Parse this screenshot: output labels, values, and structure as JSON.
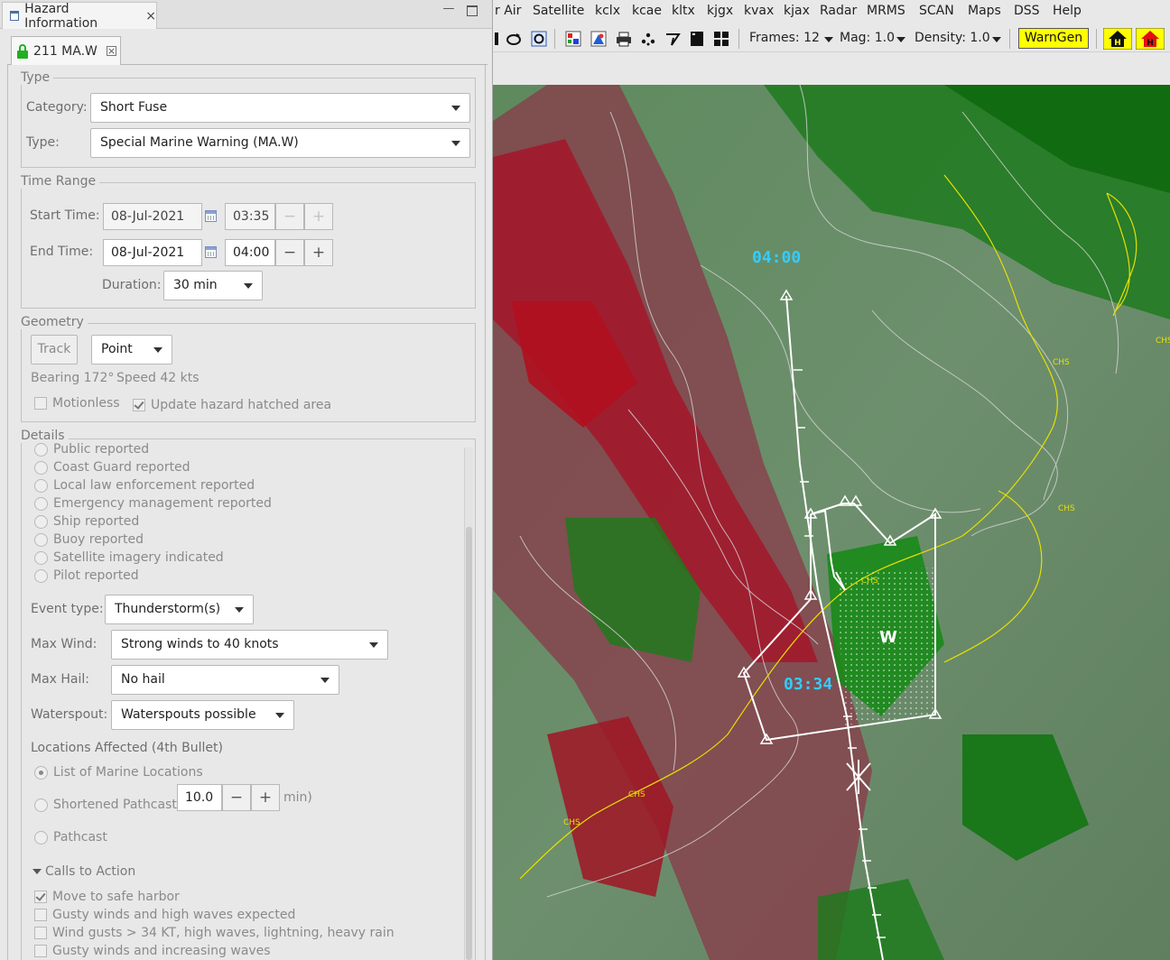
{
  "view": {
    "title": "Hazard Information"
  },
  "tab": {
    "label": "211 MA.W"
  },
  "type_group": {
    "title": "Type",
    "category_label": "Category:",
    "category_value": "Short Fuse",
    "type_label": "Type:",
    "type_value": "Special Marine Warning (MA.W)"
  },
  "time_range": {
    "title": "Time Range",
    "start_label": "Start Time:",
    "start_date": "08-Jul-2021",
    "start_time": "03:35",
    "end_label": "End Time:",
    "end_date": "08-Jul-2021",
    "end_time": "04:00",
    "duration_label": "Duration:",
    "duration_value": "30 min",
    "minus": "−",
    "plus": "+"
  },
  "geometry": {
    "title": "Geometry",
    "track_label": "Track",
    "mode_value": "Point",
    "bearing": "Bearing 172°",
    "speed": "Speed 42 kts",
    "motionless": "Motionless",
    "update_hatched": "Update hazard hatched area"
  },
  "details": {
    "title": "Details",
    "sources": [
      "Public reported",
      "Coast Guard reported",
      "Local law enforcement reported",
      "Emergency management reported",
      "Ship reported",
      "Buoy reported",
      "Satellite imagery indicated",
      "Pilot reported"
    ],
    "event_type_label": "Event type:",
    "event_type_value": "Thunderstorm(s)",
    "max_wind_label": "Max Wind:",
    "max_wind_value": "Strong winds to 40 knots",
    "max_hail_label": "Max Hail:",
    "max_hail_value": "No hail",
    "waterspout_label": "Waterspout:",
    "waterspout_value": "Waterspouts possible",
    "locations_title": "Locations Affected (4th Bullet)",
    "loc_list": "List of Marine Locations",
    "loc_short_prefix": "Shortened Pathcast (",
    "loc_short_value": "10.0",
    "loc_short_suffix": "min)",
    "loc_pathcast": "Pathcast",
    "cta_title": "Calls to Action",
    "cta": [
      "Move to safe harbor",
      "Gusty winds and high waves expected",
      "Wind gusts > 34 KT, high waves, lightning, heavy rain",
      "Gusty winds and increasing waves"
    ]
  },
  "menu": [
    "r Air",
    "Satellite",
    "kclx",
    "kcae",
    "kltx",
    "kjgx",
    "kvax",
    "kjax",
    "Radar",
    "MRMS",
    "SCAN",
    "Maps",
    "DSS",
    "Help"
  ],
  "toolbar": {
    "frames": "Frames: 12",
    "mag": "Mag: 1.0",
    "density": "Density: 1.0",
    "warngen": "WarnGen"
  },
  "map": {
    "time_end": "04:00",
    "time_start": "03:34",
    "warn_letter": "W",
    "zone_labels": [
      "CHS",
      "CHS",
      "CHS",
      "CHS",
      "CHS",
      "CHS"
    ]
  },
  "colors": {
    "accent_cyan": "#33ccff",
    "warngen_yellow": "#ffff00",
    "lock_green": "#20b020"
  }
}
